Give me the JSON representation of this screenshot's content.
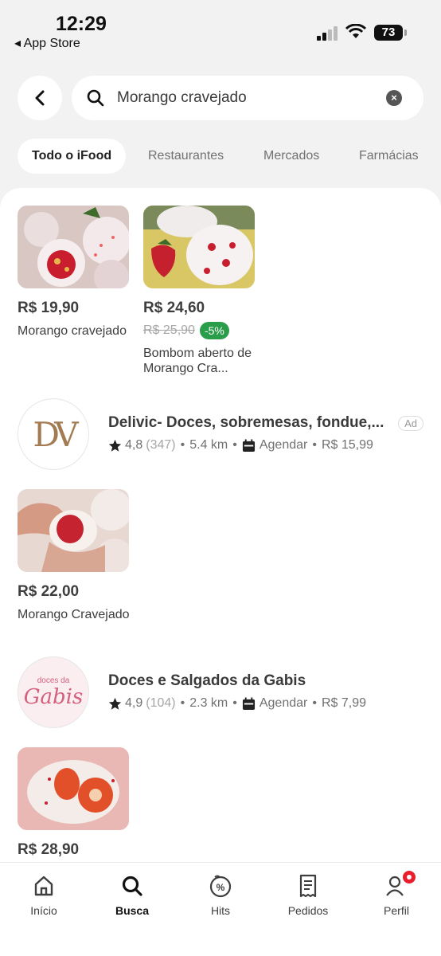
{
  "status": {
    "time": "12:29",
    "back_app": "◂ App Store",
    "battery": "73"
  },
  "search": {
    "value": "Morango cravejado"
  },
  "tabs": [
    "Todo o iFood",
    "Restaurantes",
    "Mercados",
    "Farmácias"
  ],
  "top_products": [
    {
      "price": "R$ 19,90",
      "name": "Morango cravejado"
    },
    {
      "price": "R$ 24,60",
      "old_price": "R$ 25,90",
      "discount": "-5%",
      "name": "Bombom aberto de Morango Cra..."
    }
  ],
  "shops": [
    {
      "name": "Delivic- Doces, sobremesas, fondue,...",
      "rating": "4,8",
      "reviews": "(347)",
      "distance": "5.4 km",
      "schedule": "Agendar",
      "fee": "R$ 15,99",
      "ad": "Ad",
      "logo_text": "DV",
      "product": {
        "price": "R$ 22,00",
        "name": "Morango Cravejado"
      }
    },
    {
      "name": "Doces e Salgados da Gabis",
      "rating": "4,9",
      "reviews": "(104)",
      "distance": "2.3 km",
      "schedule": "Agendar",
      "fee": "R$ 7,99",
      "logo_small": "doces da",
      "logo_text": "Gabis",
      "product": {
        "price": "R$ 28,90"
      }
    }
  ],
  "nav": [
    {
      "label": "Início",
      "icon": "home-icon"
    },
    {
      "label": "Busca",
      "icon": "search-icon"
    },
    {
      "label": "Hits",
      "icon": "percent-badge-icon"
    },
    {
      "label": "Pedidos",
      "icon": "receipt-icon"
    },
    {
      "label": "Perfil",
      "icon": "user-icon"
    }
  ],
  "colors": {
    "accent_red": "#ea1d2c",
    "discount_green": "#2a9d4a",
    "logo_gold": "#a27b52",
    "logo_pink": "#d4607e"
  }
}
